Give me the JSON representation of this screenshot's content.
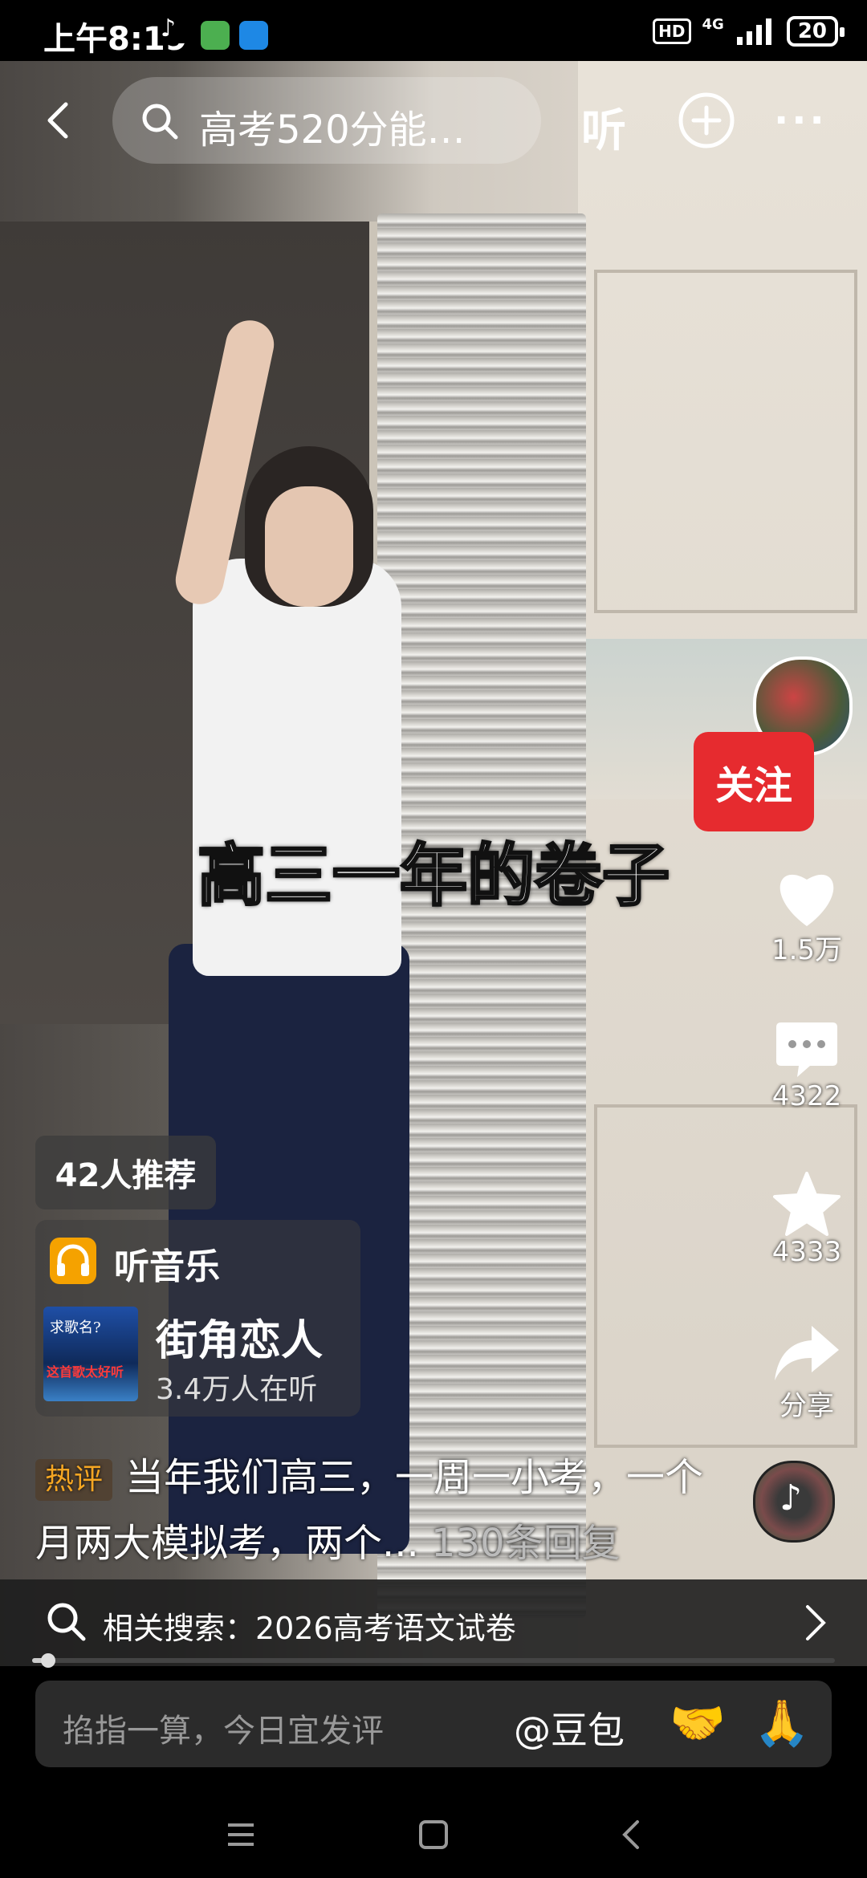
{
  "status_bar": {
    "time": "上午8:19",
    "hd": "HD",
    "network": "4G",
    "battery": "20"
  },
  "top_bar": {
    "search_text": "高考520分能…",
    "listen_label": "听"
  },
  "video": {
    "caption": "高三一年的卷子"
  },
  "side_actions": {
    "follow_label": "关注",
    "likes": "1.5万",
    "comments": "4322",
    "favorites": "4333",
    "share_label": "分享"
  },
  "recommend": {
    "text": "42人推荐"
  },
  "music": {
    "label": "听音乐",
    "thumb_line1": "求歌名?",
    "thumb_line2": "这首歌太好听",
    "song_title": "街角恋人",
    "listeners": "3.4万人在听"
  },
  "hot_comment": {
    "tag": "热评",
    "text": "当年我们高三，一周一小考，一个月两大模拟考，两个...",
    "replies": "130条回复"
  },
  "related_search": {
    "text": "相关搜索：2026高考语文试卷"
  },
  "progress": {
    "value": 0.02
  },
  "input_bar": {
    "placeholder": "掐指一算，今日宜发评",
    "mention": "@豆包",
    "emoji1": "🤝",
    "emoji2": "🙏"
  },
  "colors": {
    "follow_red": "#e62b2f",
    "hot_tag": "#f5a623",
    "music_icon": "#f5a200"
  }
}
